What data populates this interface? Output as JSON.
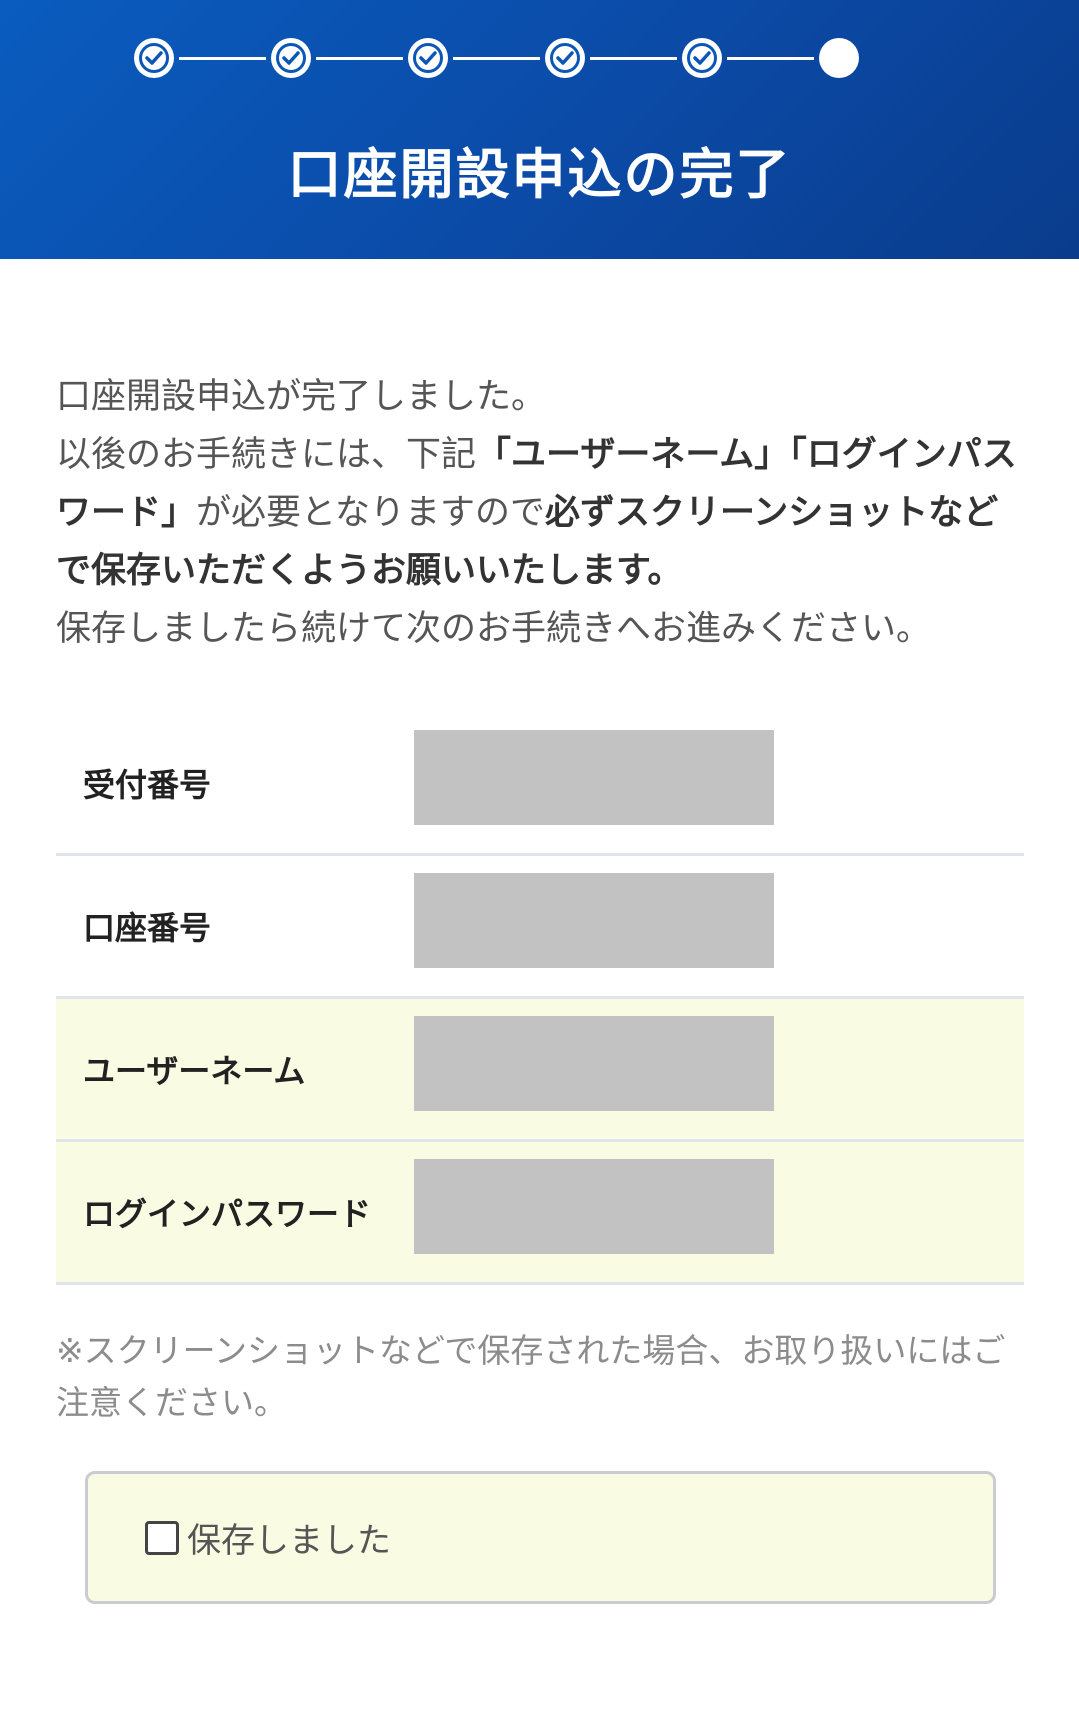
{
  "header": {
    "title": "口座開設申込の完了",
    "steps": [
      {
        "state": "done",
        "icon": "check-circle-icon"
      },
      {
        "state": "done",
        "icon": "check-circle-icon"
      },
      {
        "state": "done",
        "icon": "check-circle-icon"
      },
      {
        "state": "done",
        "icon": "check-circle-icon"
      },
      {
        "state": "done",
        "icon": "check-circle-icon"
      },
      {
        "state": "current",
        "icon": "filled-circle-icon"
      }
    ]
  },
  "intro": {
    "line1": "口座開設申込が完了しました。",
    "line2_prefix": "以後のお手続きには、下記",
    "line2_bold_keys": "「ユーザーネーム」「ログインパスワード」",
    "line2_middle": "が必要となりますので",
    "line2_bold_action": "必ずスクリーンショットなどで保存いただくようお願いいたします。",
    "line3": "保存しましたら続けて次のお手続きへお進みください。"
  },
  "table": {
    "rows": [
      {
        "label": "受付番号",
        "highlight": false
      },
      {
        "label": "口座番号",
        "highlight": false
      },
      {
        "label": "ユーザーネーム",
        "highlight": true
      },
      {
        "label": "ログインパスワード",
        "highlight": true
      }
    ]
  },
  "note": "※スクリーンショットなどで保存された場合、お取り扱いにはご注意ください。",
  "confirm": {
    "label": "保存しました",
    "checked": false
  },
  "colors": {
    "header_start": "#0a5cbf",
    "header_end": "#0a3c8c",
    "highlight_bg": "#fafbe3",
    "masked_value": "#c2c2c2"
  }
}
